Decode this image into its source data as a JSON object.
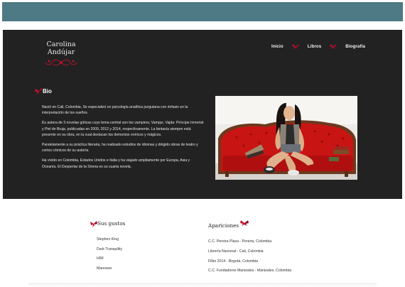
{
  "logo": {
    "line1": "Carolina",
    "line2": "Andújar"
  },
  "nav": {
    "items": [
      "Inicio",
      "Libros",
      "Biografía"
    ]
  },
  "bio": {
    "title": "Bio",
    "paragraphs": [
      "Nació en Cali, Colombia. Se especializó en psicología analítica junguiana con énfasis en la interpretación de los sueños.",
      "Es autora de 3 novelas góticas cuyo tema central son los vampiros; Vampyr, Vajda: Príncipe Inmortal y Piel de Bruja, publicadas en 2009, 2012 y 2014, respectivamente. La fantasía siempre está presente en su obra, en la cual destacan los demonios oníricos y mágicos.",
      "Paralelamente a su práctica literaria, ha realizado estudios de idiomas y dirigido obras de teatro y cortos cómicos de su autoría.",
      "Ha vivido en Colombia, Estados Unidos e Italia y ha viajado ampliamente por Europa, Asia y Oceanía. El Despertar de la Sirena es su cuarta novela."
    ]
  },
  "likes": {
    "title": "Sus gustos",
    "items": [
      "Stephen King",
      "Dark Tranquility",
      "HIM",
      "Manowar"
    ]
  },
  "appearances": {
    "title": "Apariciones",
    "items": [
      "C.C. Pereira Plaza - Pereira, Colombia",
      "Librería Nacional - Cali, Colombia",
      "Filbo 2014 - Bogotá, Colombia",
      "C.C. Fundadores Manizales - Manizales, Colombia"
    ]
  },
  "colors": {
    "accent": "#c8102e",
    "dark_bg": "#222222",
    "top_bar": "#4d7a84"
  },
  "icons": [
    "butterfly-icon",
    "ornament-icon"
  ]
}
